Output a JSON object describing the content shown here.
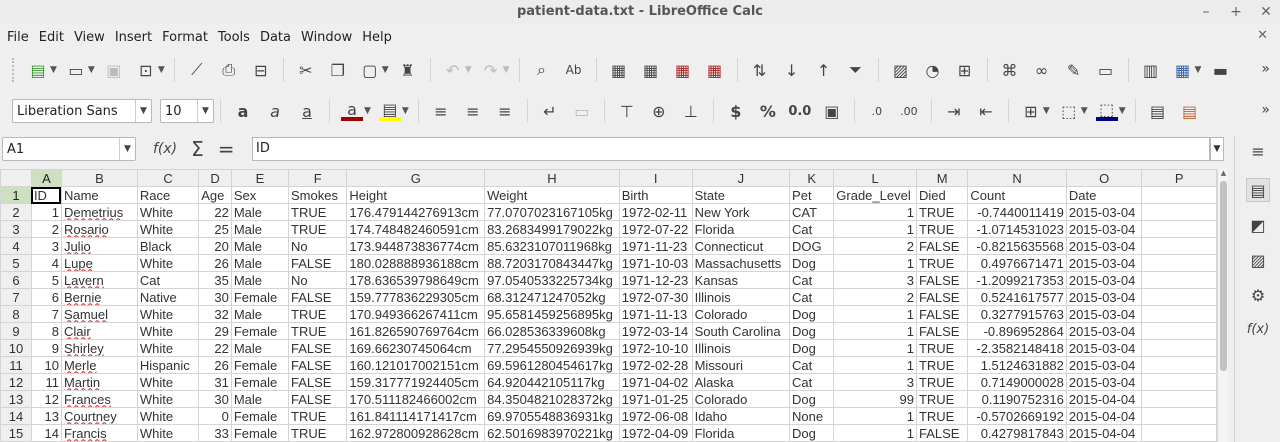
{
  "window": {
    "title": "patient-data.txt - LibreOffice Calc"
  },
  "menu": [
    "File",
    "Edit",
    "View",
    "Insert",
    "Format",
    "Tools",
    "Data",
    "Window",
    "Help"
  ],
  "font": {
    "name": "Liberation Sans",
    "size": "10"
  },
  "namebox": "A1",
  "formula": "ID",
  "columns": [
    "A",
    "B",
    "C",
    "D",
    "E",
    "F",
    "G",
    "H",
    "I",
    "J",
    "K",
    "L",
    "M",
    "N",
    "O",
    "P"
  ],
  "rows": [
    [
      "ID",
      "Name",
      "Race",
      "Age",
      "Sex",
      "Smokes",
      "Height",
      "Weight",
      "Birth",
      "State",
      "Pet",
      "Grade_Level",
      "Died",
      "Count",
      "Date",
      ""
    ],
    [
      "1",
      "Demetrius",
      "White",
      "22",
      "Male",
      "TRUE",
      "176.479144276913cm",
      "77.0707023167105kg",
      "1972-02-11",
      "New York",
      "CAT",
      "1",
      "TRUE",
      "-0.7440011419",
      "2015-03-04",
      ""
    ],
    [
      "2",
      "Rosario",
      "White",
      "25",
      " Male",
      "TRUE",
      "174.748482460591cm",
      "83.2683499179022kg",
      "1972-07-22",
      "Florida",
      "Cat",
      "1",
      "TRUE",
      "-1.0714531023",
      "2015-03-04",
      ""
    ],
    [
      "3",
      "Julio",
      "Black",
      "20",
      "Male",
      "No",
      "173.944873836774cm",
      "85.6323107011968kg",
      "1971-11-23",
      "Connecticut",
      "DOG",
      "2",
      "FALSE",
      "-0.8215635568",
      "2015-03-04",
      ""
    ],
    [
      "4",
      "Lupe",
      "White",
      "26",
      "Male",
      "FALSE",
      "180.028888936188cm",
      "88.7203170843447kg",
      "1971-10-03",
      "Massachusetts",
      "Dog",
      "1",
      "TRUE",
      "0.4976671471",
      "2015-03-04",
      ""
    ],
    [
      "5",
      "Lavern",
      "Cat",
      "35",
      "Male",
      "No",
      "178.636539798649cm",
      "97.0540533225734kg",
      "1971-12-23",
      "Kansas",
      "Cat",
      "3",
      "FALSE",
      "-1.2099217353",
      "2015-03-04",
      ""
    ],
    [
      "6",
      "Bernie",
      "Native",
      "30",
      "Female",
      "FALSE",
      "159.777836229305cm",
      "68.312471247052kg",
      "1972-07-30",
      "Illinois",
      "Cat",
      "2",
      "FALSE",
      "0.5241617577",
      "2015-03-04",
      ""
    ],
    [
      "7",
      "Samuel",
      "White",
      "32",
      "Male",
      "TRUE",
      "170.949366267411cm",
      "95.6581459256895kg",
      "1971-11-13",
      "Colorado",
      "Dog",
      "1",
      "FALSE",
      "0.3277915763",
      "2015-03-04",
      ""
    ],
    [
      "8",
      "Clair",
      "White",
      "29",
      "Female",
      "TRUE",
      "161.826590769764cm",
      "66.028536339608kg",
      "1972-03-14",
      "South Carolina",
      "Dog",
      "1",
      "FALSE",
      "-0.896952864",
      "2015-03-04",
      ""
    ],
    [
      "9",
      "Shirley",
      "White",
      "22",
      "Male",
      "FALSE",
      "169.66230745064cm",
      "77.2954550926939kg",
      "1972-10-10",
      "Illinois",
      "Dog",
      "1",
      "TRUE",
      "-2.3582148418",
      "2015-03-04",
      ""
    ],
    [
      "10",
      "Merle",
      "Hispanic",
      "26",
      " Female",
      "FALSE",
      "160.121017002151cm",
      "69.5961280454617kg",
      "1972-02-28",
      "Missouri",
      "Cat",
      "1",
      "TRUE",
      "1.5124631882",
      "2015-03-04",
      ""
    ],
    [
      "11",
      "Martin",
      "White",
      "31",
      "Female",
      "FALSE",
      "159.317771924405cm",
      "64.920442105117kg",
      "1971-04-02",
      "Alaska",
      "Cat",
      "3",
      "TRUE",
      "0.7149000028",
      "2015-03-04",
      ""
    ],
    [
      "12",
      "Frances",
      "White",
      "30",
      "Male",
      "FALSE",
      "170.511182466002cm",
      "84.3504821028372kg",
      "1971-01-25",
      "Colorado",
      "Dog",
      "99",
      "TRUE",
      "0.1190752316",
      "2015-04-04",
      ""
    ],
    [
      "13",
      "Courtney",
      "White",
      "0",
      "Female",
      "TRUE",
      "161.841114171417cm",
      "69.9705548836931kg",
      "1972-06-08",
      "Idaho",
      "None",
      "1",
      "TRUE",
      "-0.5702669192",
      "2015-04-04",
      ""
    ],
    [
      "14",
      "Francis",
      "White",
      "33",
      "Female",
      "TRUE",
      "162.972800928628cm",
      "62.5016983970221kg",
      "1972-04-09",
      "Florida",
      "Dog",
      "1",
      "FALSE",
      "0.4279817843",
      "2015-04-04",
      ""
    ]
  ],
  "row_numbers": [
    "1",
    "2",
    "3",
    "4",
    "5",
    "6",
    "7",
    "8",
    "9",
    "10",
    "11",
    "12",
    "13",
    "14",
    "15"
  ],
  "icons": {
    "toolbar1": [
      "new-icon",
      "templates-icon",
      "open-icon",
      "save-icon",
      "export-pdf-icon",
      "print-icon",
      "print-preview-icon",
      "cut-icon",
      "copy-icon",
      "paste-icon",
      "clone-formatting-icon",
      "undo-icon",
      "redo-icon",
      "find-replace-icon",
      "spelling-icon",
      "row-icon",
      "column-icon",
      "delete-row-icon",
      "delete-column-icon",
      "sort-icon",
      "sort-ascending-icon",
      "sort-descending-icon",
      "autofilter-icon",
      "image-icon",
      "chart-icon",
      "pivot-table-icon",
      "special-character-icon",
      "hyperlink-icon",
      "comment-icon",
      "headers-footers-icon",
      "define-print-area-icon",
      "freeze-icon",
      "split-window-icon"
    ],
    "sidebar": [
      "sidebar-menu-icon",
      "properties-icon",
      "styles-icon",
      "gallery-icon",
      "navigator-icon",
      "functions-icon"
    ]
  }
}
